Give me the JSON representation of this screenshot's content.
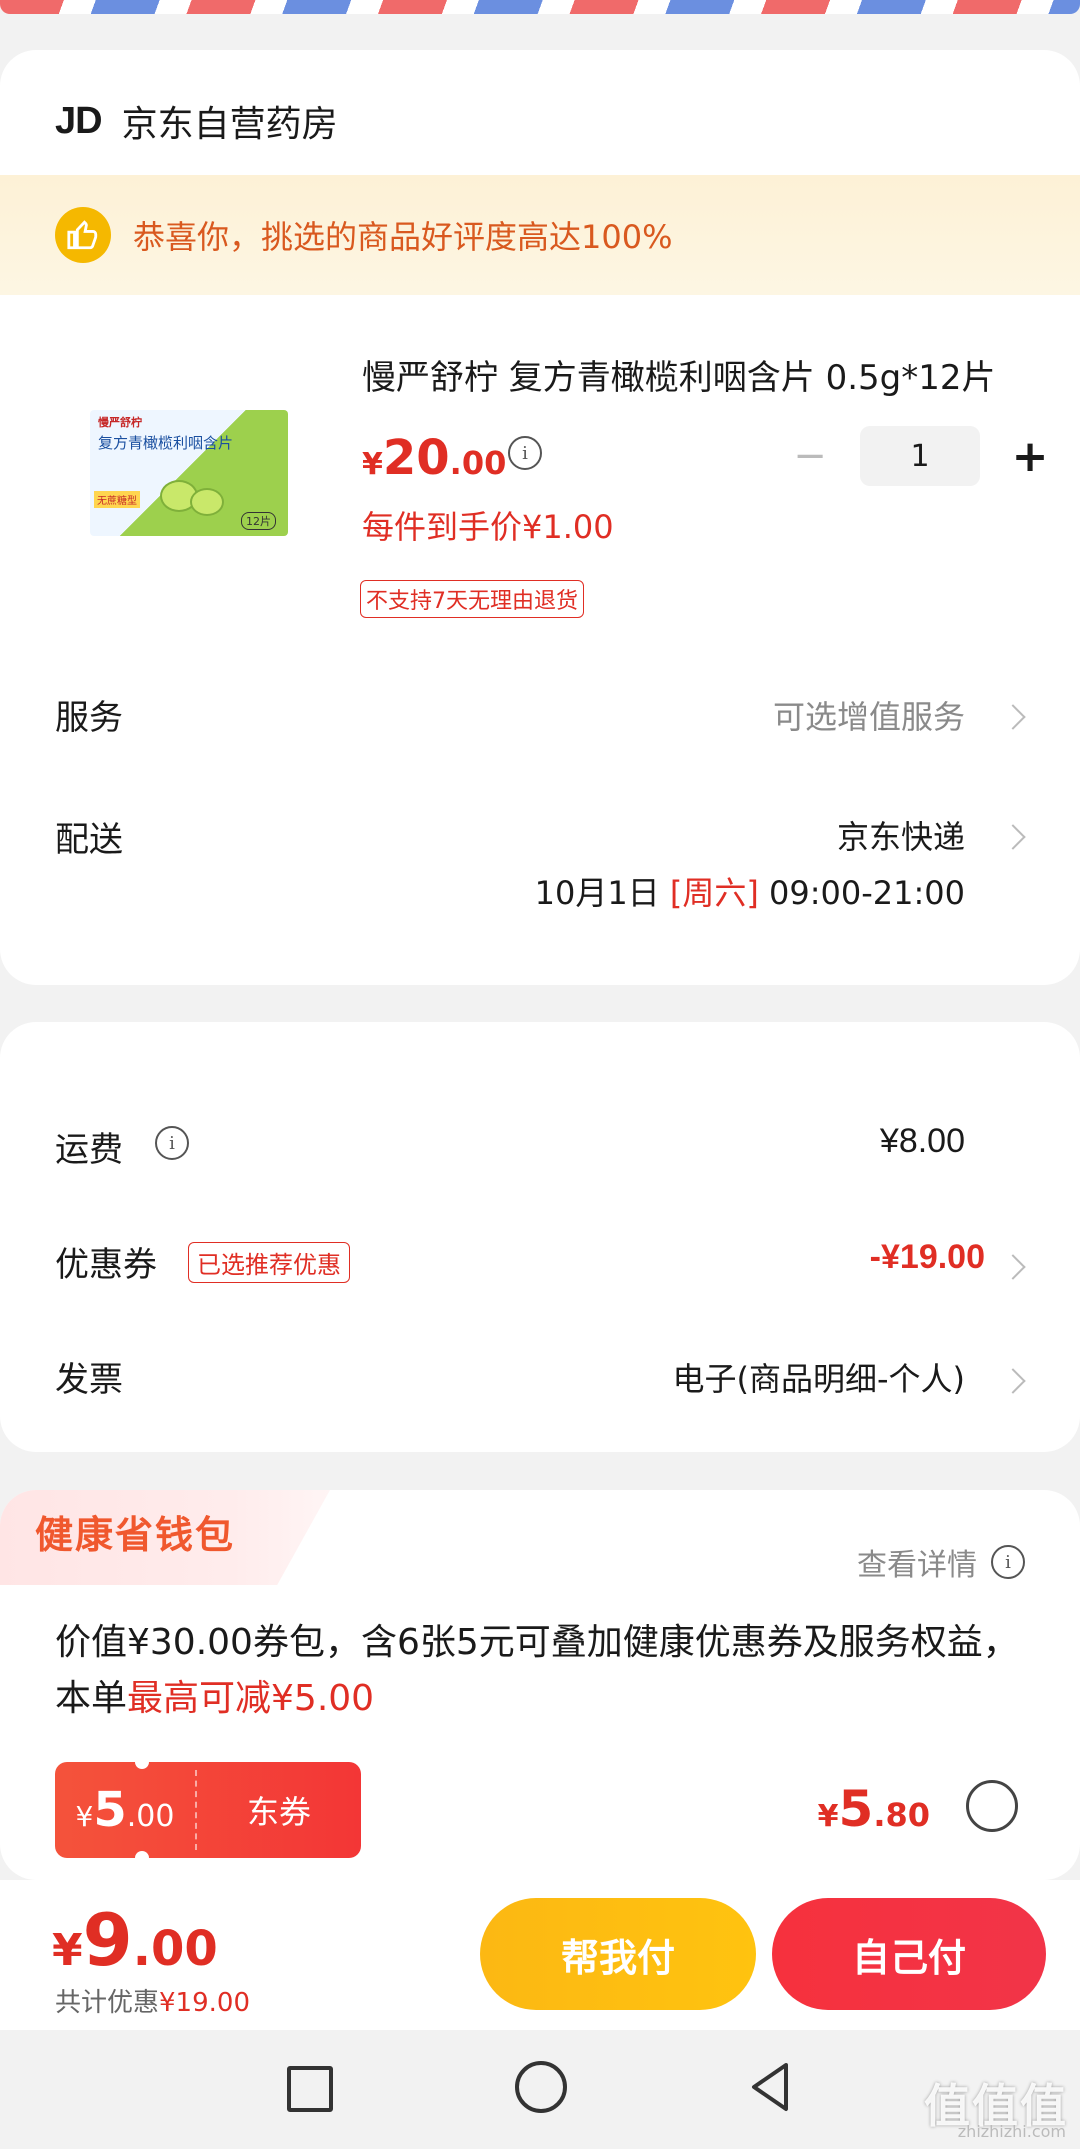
{
  "shop": {
    "logo": "JD",
    "name": "京东自营药房"
  },
  "banner": {
    "text": "恭喜你，挑选的商品好评度高达100%"
  },
  "product": {
    "title": "慢严舒柠 复方青橄榄利咽含片 0.5g*12片",
    "price_symbol": "¥",
    "price_int": "20",
    "price_dec": ".00",
    "unit_price": "每件到手价¥1.00",
    "no_return": "不支持7天无理由退货",
    "quantity": "1",
    "minus": "−",
    "plus": "+",
    "image_brand": "慢严舒柠",
    "image_name": "复方青橄榄利咽含片",
    "image_tag": "无蔗糖型",
    "image_count": "12片"
  },
  "service": {
    "label": "服务",
    "value": "可选增值服务"
  },
  "delivery": {
    "label": "配送",
    "value": "京东快递",
    "date": "10月1日",
    "weekday": "[周六]",
    "time": "09:00-21:00"
  },
  "fees": {
    "shipping_label": "运费",
    "shipping_value": "¥8.00",
    "coupon_label": "优惠券",
    "coupon_badge": "已选推荐优惠",
    "coupon_value": "-¥19.00",
    "invoice_label": "发票",
    "invoice_value": "电子(商品明细-个人)"
  },
  "wallet": {
    "title": "健康省钱包",
    "detail": "查看详情",
    "desc_a": "价值¥30.00券包，含6张5元可叠加健康优惠券及服务权益，本单",
    "desc_b": "最高可减¥5.00",
    "ticket_symbol": "¥",
    "ticket_int": "5",
    "ticket_dec": ".00",
    "ticket_label": "东券",
    "buy_symbol": "¥",
    "buy_int": "5",
    "buy_dec": ".80",
    "selected": false
  },
  "footer": {
    "total_symbol": "¥",
    "total_int": "9",
    "total_dec": ".00",
    "saved_label": "共计优惠",
    "saved_value": "¥19.00",
    "help_pay": "帮我付",
    "self_pay": "自己付"
  },
  "watermark": {
    "main": "值值值",
    "sub": "zhizhizhi.com"
  },
  "icons": {
    "info": "i",
    "thumb": "thumbs-up",
    "chevron": "chevron-right"
  },
  "colors": {
    "accent_red": "#e02e24",
    "orange_banner_text": "#d9591f",
    "yellow_button": "#fcb813",
    "red_button": "#f6313d"
  }
}
